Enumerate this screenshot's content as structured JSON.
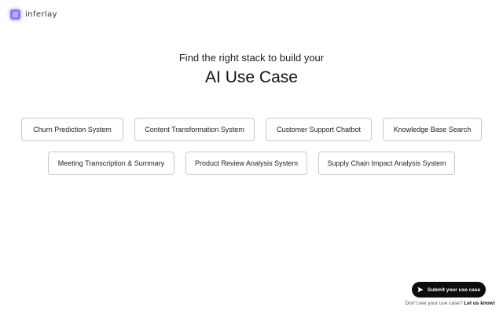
{
  "brand": {
    "name": "inferlay",
    "logo_color": "#8b7cf6"
  },
  "hero": {
    "subtitle": "Find the right stack to build your",
    "title": "AI Use Case"
  },
  "use_cases": {
    "row1": [
      "Churn Prediction System",
      "Content Transformation System",
      "Customer Support Chatbot",
      "Knowledge Base Search"
    ],
    "row2": [
      "Meeting Transcription & Summary",
      "Product Review Analysis System",
      "Supply Chain Impact Analysis System"
    ]
  },
  "submit": {
    "label": "Submit your use case",
    "icon": "send-icon",
    "background": "#0d0d0d"
  },
  "footer": {
    "prompt": "Don't see your use case?",
    "link_label": "Let us know!"
  }
}
